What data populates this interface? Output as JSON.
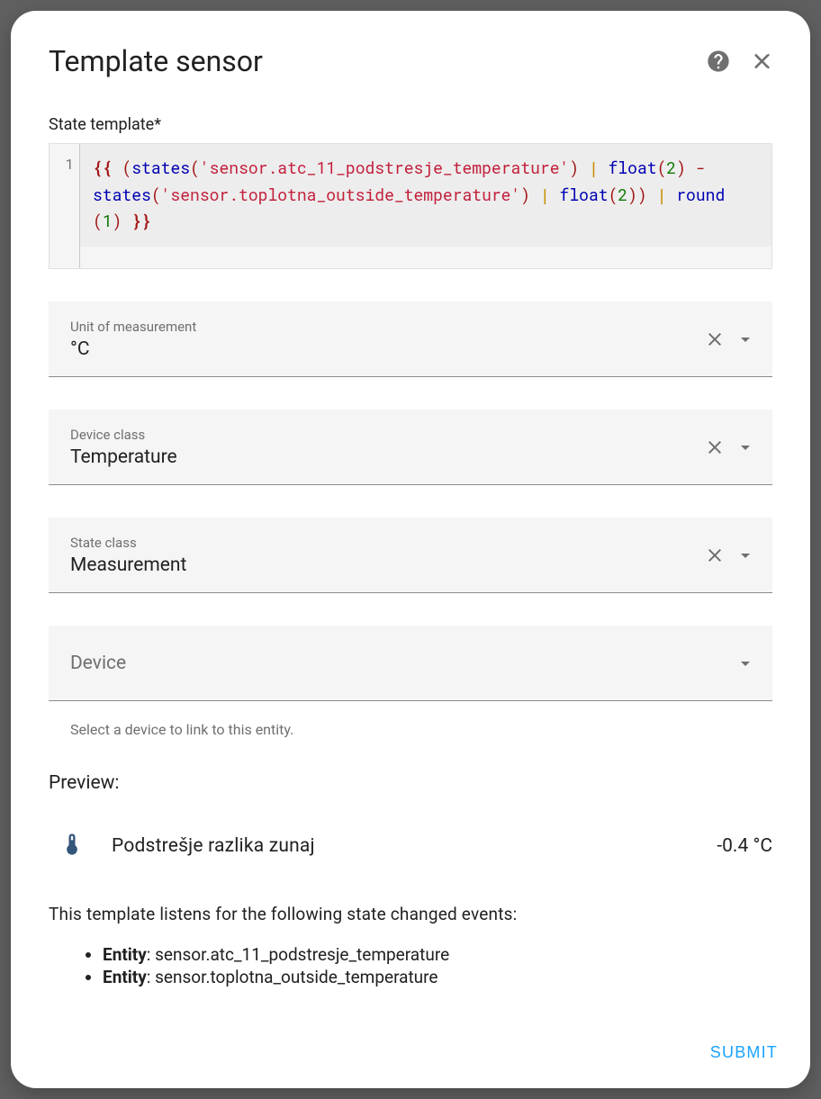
{
  "dialog": {
    "title": "Template sensor",
    "state_template_label": "State template*",
    "submit_label": "SUBMIT"
  },
  "code": {
    "line_no": "1",
    "tokens": {
      "open_brace": "{{",
      "open_paren": "(",
      "states1": "states",
      "paren_l1": "(",
      "str1": "'sensor.atc_11_podstresje_temperature'",
      "paren_r1": ")",
      "pipe1": "|",
      "float1": "float",
      "paren_l2": "(",
      "num2a": "2",
      "paren_r2": ")",
      "minus": "-",
      "states2": "states",
      "paren_l3": "(",
      "str2": "'sensor.toplotna_outside_temperature'",
      "paren_r3": ")",
      "pipe2": "|",
      "float2": "float",
      "paren_l4": "(",
      "num2b": "2",
      "paren_r4": "))",
      "pipe3": "|",
      "round": "round",
      "paren_l5": "(",
      "num1": "1",
      "paren_r5": ")",
      "close_brace": "}}"
    }
  },
  "fields": {
    "uom": {
      "label": "Unit of measurement",
      "value": "°C"
    },
    "device_class": {
      "label": "Device class",
      "value": "Temperature"
    },
    "state_class": {
      "label": "State class",
      "value": "Measurement"
    },
    "device": {
      "label": "Device",
      "helper": "Select a device to link to this entity."
    }
  },
  "preview": {
    "heading": "Preview:",
    "entity_name": "Podstrešje razlika zunaj",
    "entity_value": "-0.4 °C",
    "listens_text": "This template listens for the following state changed events:",
    "entity_label": "Entity",
    "entities": [
      "sensor.atc_11_podstresje_temperature",
      "sensor.toplotna_outside_temperature"
    ]
  }
}
